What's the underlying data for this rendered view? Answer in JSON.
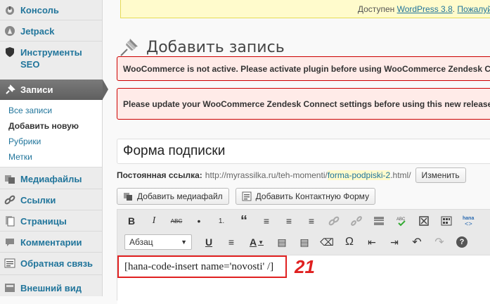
{
  "sidebar": {
    "console": "Консоль",
    "jetpack": "Jetpack",
    "seo_tools": "Инструменты SEO",
    "posts": "Записи",
    "submenu": [
      "Все записи",
      "Добавить новую",
      "Рубрики",
      "Метки"
    ],
    "media": "Медиафайлы",
    "links": "Ссылки",
    "pages": "Страницы",
    "comments": "Комментарии",
    "feedback": "Обратная связь",
    "appearance": "Внешний вид"
  },
  "update_nag": {
    "prefix": "Доступен",
    "link": "WordPress 3.8",
    "suffix": "Пожалуй"
  },
  "page_title": "Добавить запись",
  "notices": [
    "WooCommerce is not active. Please activate plugin before using WooCommerce Zendesk Co",
    "Please update your WooCommerce Zendesk Connect settings before using this new release"
  ],
  "post_title": "Форма подписки",
  "permalink": {
    "label": "Постоянная ссылка:",
    "base": "http://myrassilka.ru/teh-momenti/",
    "slug": "forma-podpiski-2",
    "ext": ".html/",
    "edit_button": "Изменить"
  },
  "media_buttons": {
    "add_media": "Добавить медиафайл",
    "add_contact_form": "Добавить Контактную Форму"
  },
  "toolbar": {
    "format_select": "Абзац",
    "row1": [
      "B",
      "I",
      "ABC",
      "•",
      "1.",
      "“",
      "≡",
      "≡",
      "≡",
      "link",
      "unlink",
      "more",
      "ABC",
      "⤢",
      "▦",
      "hana"
    ],
    "row2": [
      "U",
      "≡",
      "A",
      "▤",
      "▤",
      "⌫",
      "Ω",
      "⇤",
      "⇥",
      "↶",
      "↷",
      "?"
    ]
  },
  "editor_content": "[hana-code-insert name='novosti' /]",
  "annotation": "21",
  "colors": {
    "link": "#21759b",
    "notice_border": "#cc0000",
    "annotation": "#e02020"
  }
}
